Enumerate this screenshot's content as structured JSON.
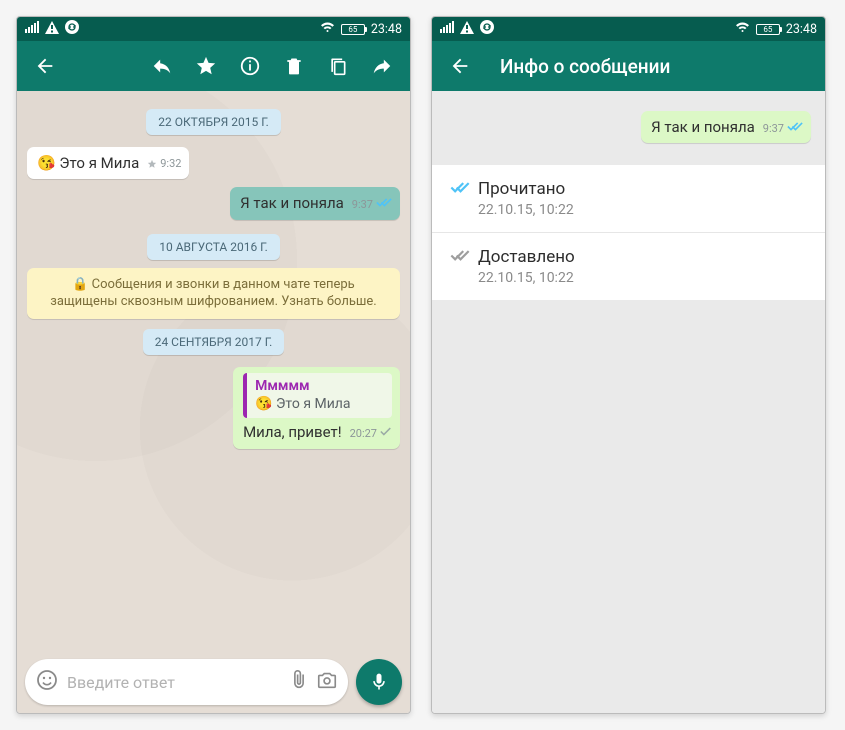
{
  "status": {
    "battery": "65",
    "time": "23:48"
  },
  "chat": {
    "dates": {
      "d1": "22 ОКТЯБРЯ 2015 Г.",
      "d2": "10 АВГУСТА 2016 Г.",
      "d3": "24 СЕНТЯБРЯ 2017 Г."
    },
    "m1": {
      "text": "Это я Мила",
      "time": "9:32"
    },
    "m2": {
      "text": "Я так и поняла",
      "time": "9:37"
    },
    "encryption": "🔒 Сообщения и звонки в данном чате теперь защищены сквозным шифрованием. Узнать больше.",
    "m3": {
      "quote_name": "Ммммм",
      "quote_text": "Это я Мила",
      "text": "Мила, привет!",
      "time": "20:27"
    },
    "input_placeholder": "Введите ответ"
  },
  "info": {
    "title": "Инфо о сообщении",
    "bubble": {
      "text": "Я так и поняла",
      "time": "9:37"
    },
    "read": {
      "label": "Прочитано",
      "time": "22.10.15, 10:22"
    },
    "delivered": {
      "label": "Доставлено",
      "time": "22.10.15, 10:22"
    }
  }
}
